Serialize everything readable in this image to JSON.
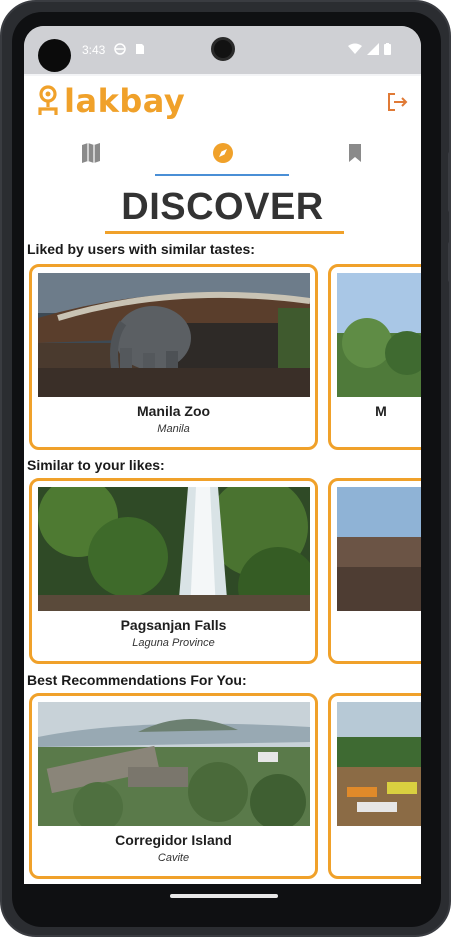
{
  "status_bar": {
    "time": "3:43"
  },
  "app": {
    "logo_text": "lakbay",
    "accent_color": "#f0a12a",
    "logout_icon": "logout-icon"
  },
  "tabs": [
    {
      "name": "map",
      "icon": "map-icon",
      "active": false
    },
    {
      "name": "discover",
      "icon": "compass-icon",
      "active": true
    },
    {
      "name": "saved",
      "icon": "bookmark-icon",
      "active": false
    }
  ],
  "page": {
    "title": "DISCOVER"
  },
  "sections": [
    {
      "title": "Liked by users with similar tastes:",
      "cards": [
        {
          "name": "Manila Zoo",
          "location": "Manila"
        },
        {
          "name": "M",
          "location": ""
        }
      ]
    },
    {
      "title": "Similar to your likes:",
      "cards": [
        {
          "name": "Pagsanjan Falls",
          "location": "Laguna Province"
        },
        {
          "name": "",
          "location": ""
        }
      ]
    },
    {
      "title": "Best Recommendations For You:",
      "cards": [
        {
          "name": "Corregidor Island",
          "location": "Cavite"
        },
        {
          "name": "",
          "location": ""
        }
      ]
    }
  ]
}
